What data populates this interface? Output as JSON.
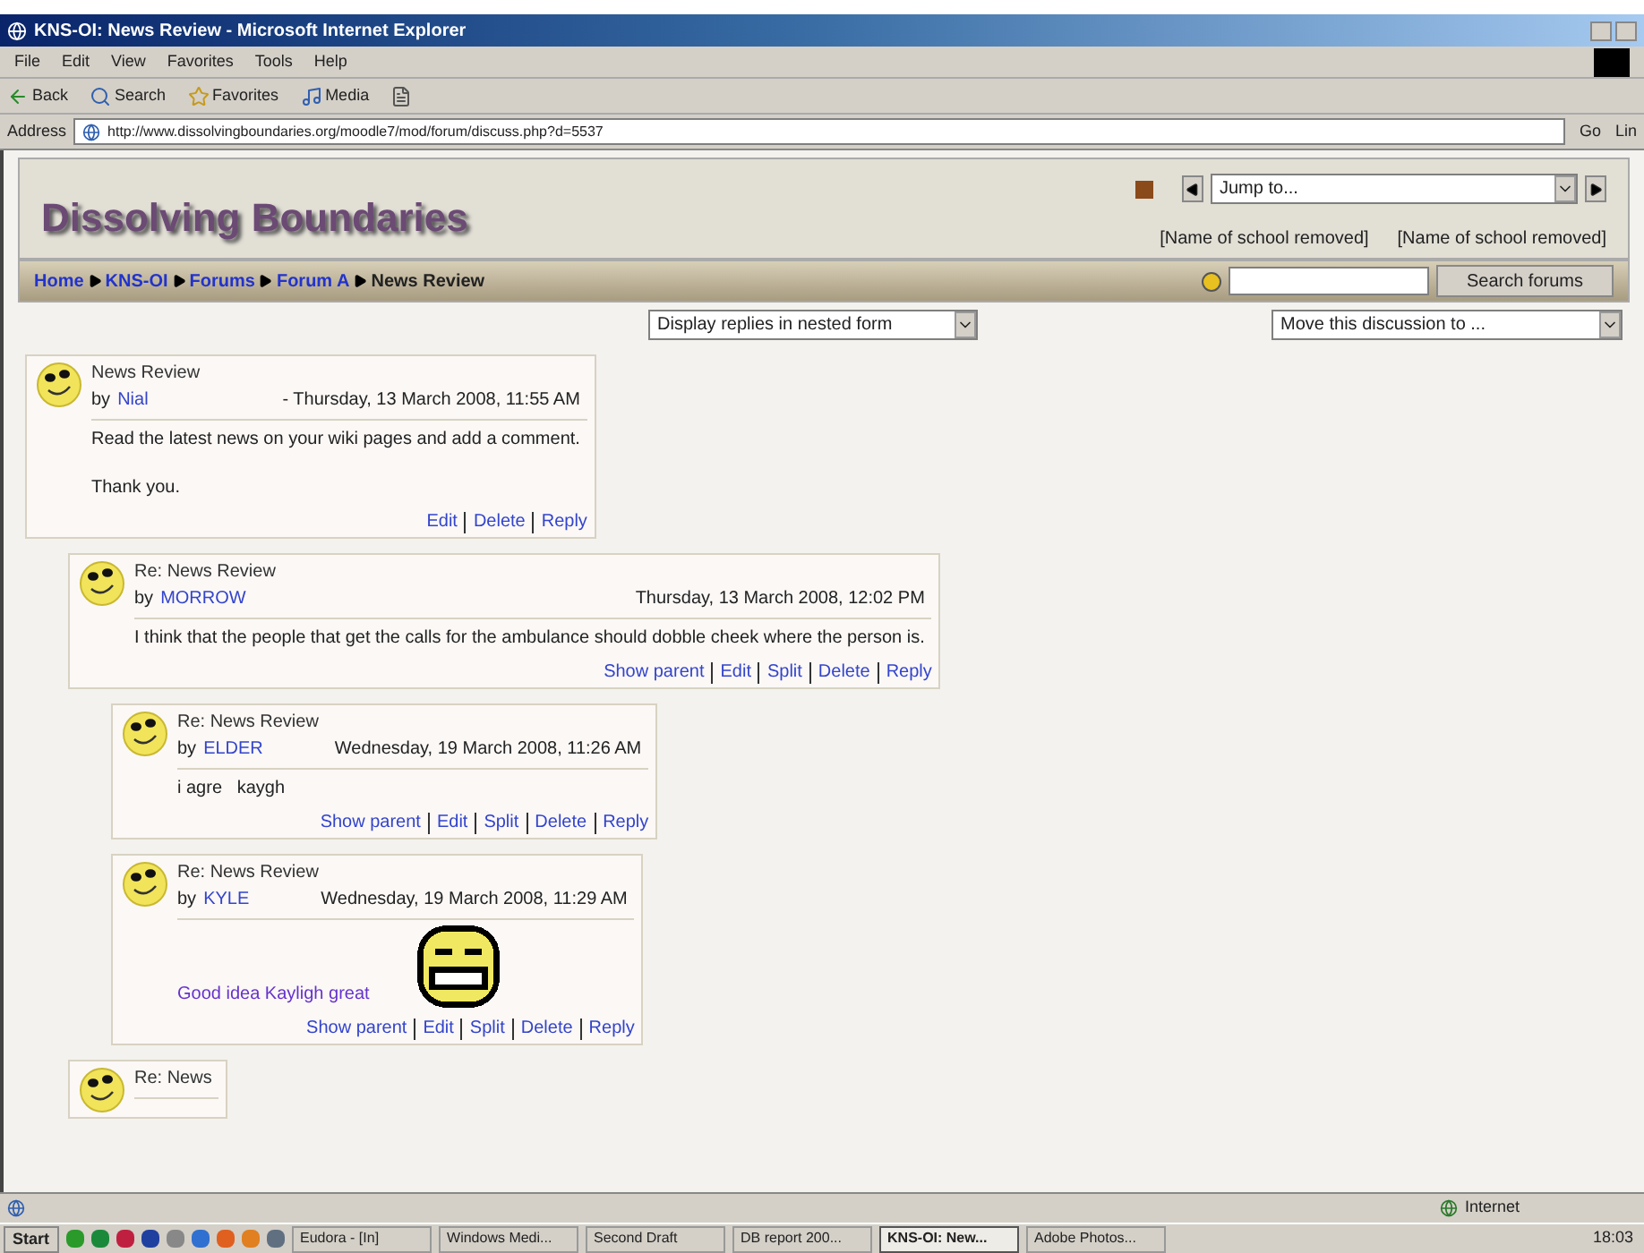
{
  "window": {
    "title": "KNS-OI: News Review - Microsoft Internet Explorer"
  },
  "menu": [
    "File",
    "Edit",
    "View",
    "Favorites",
    "Tools",
    "Help"
  ],
  "toolbar": [
    {
      "label": "Back",
      "kind": "back"
    },
    {
      "label": "Search",
      "kind": "search"
    },
    {
      "label": "Favorites",
      "kind": "favorites"
    },
    {
      "label": "Media",
      "kind": "media"
    }
  ],
  "address": {
    "label": "Address",
    "url": "http://www.dissolvingboundaries.org/moodle7/mod/forum/discuss.php?d=5537",
    "go": "Go",
    "links": "Lin"
  },
  "page": {
    "site_title": "Dissolving Boundaries",
    "jump_to": "Jump to...",
    "schools": [
      "[Name of school removed]",
      "[Name of school removed]"
    ],
    "breadcrumb": [
      {
        "label": "Home",
        "kind": "link"
      },
      {
        "label": "KNS-OI",
        "kind": "link"
      },
      {
        "label": "Forums",
        "kind": "link"
      },
      {
        "label": "Forum A",
        "kind": "link"
      },
      {
        "label": "News Review",
        "kind": "current"
      }
    ],
    "search_button": "Search forums",
    "display_select": "Display replies in nested form",
    "move_select": "Move this discussion to ...",
    "posts": [
      {
        "subject": "News Review",
        "author_prefix": "by",
        "author": "Nial",
        "date": "- Thursday, 13 March 2008, 11:55 AM",
        "body": [
          {
            "kind": "text",
            "text": "Read the latest news on your wiki pages and add a comment."
          },
          {
            "kind": "text",
            "text": "Thank you."
          }
        ],
        "actions": [
          "Edit",
          "Delete",
          "Reply"
        ],
        "children": [
          {
            "subject": "Re: News Review",
            "author_prefix": "by",
            "author": "MORROW",
            "date": "Thursday, 13 March 2008, 12:02 PM",
            "body": [
              {
                "kind": "text",
                "text": "I think that the people that get the calls for the ambulance should dobble cheek where the person is."
              }
            ],
            "actions": [
              "Show parent",
              "Edit",
              "Split",
              "Delete",
              "Reply"
            ],
            "children": [
              {
                "subject": "Re: News Review",
                "author_prefix": "by",
                "author": "ELDER",
                "date": "Wednesday, 19 March 2008, 11:26 AM",
                "body": [
                  {
                    "kind": "text",
                    "text": "i agre   kaygh"
                  }
                ],
                "actions": [
                  "Show parent",
                  "Edit",
                  "Split",
                  "Delete",
                  "Reply"
                ]
              },
              {
                "subject": "Re: News Review",
                "author_prefix": "by",
                "author": "KYLE",
                "date": "Wednesday, 19 March 2008, 11:29 AM",
                "body": [
                  {
                    "kind": "emoticon",
                    "text": "Good idea Kayligh great"
                  }
                ],
                "actions": [
                  "Show parent",
                  "Edit",
                  "Split",
                  "Delete",
                  "Reply"
                ]
              }
            ]
          },
          {
            "subject": "Re: News"
          }
        ]
      }
    ]
  },
  "status_bar": {
    "zone": "Internet"
  },
  "taskbar": {
    "start": "Start",
    "tasks": [
      {
        "label": "Eudora - [In]",
        "selected": false
      },
      {
        "label": "Windows Medi...",
        "selected": false
      },
      {
        "label": "Second Draft",
        "selected": false
      },
      {
        "label": "DB report 200...",
        "selected": false
      },
      {
        "label": "KNS-OI: New...",
        "selected": true
      },
      {
        "label": "Adobe Photos...",
        "selected": false
      }
    ],
    "clock": "18:03"
  }
}
